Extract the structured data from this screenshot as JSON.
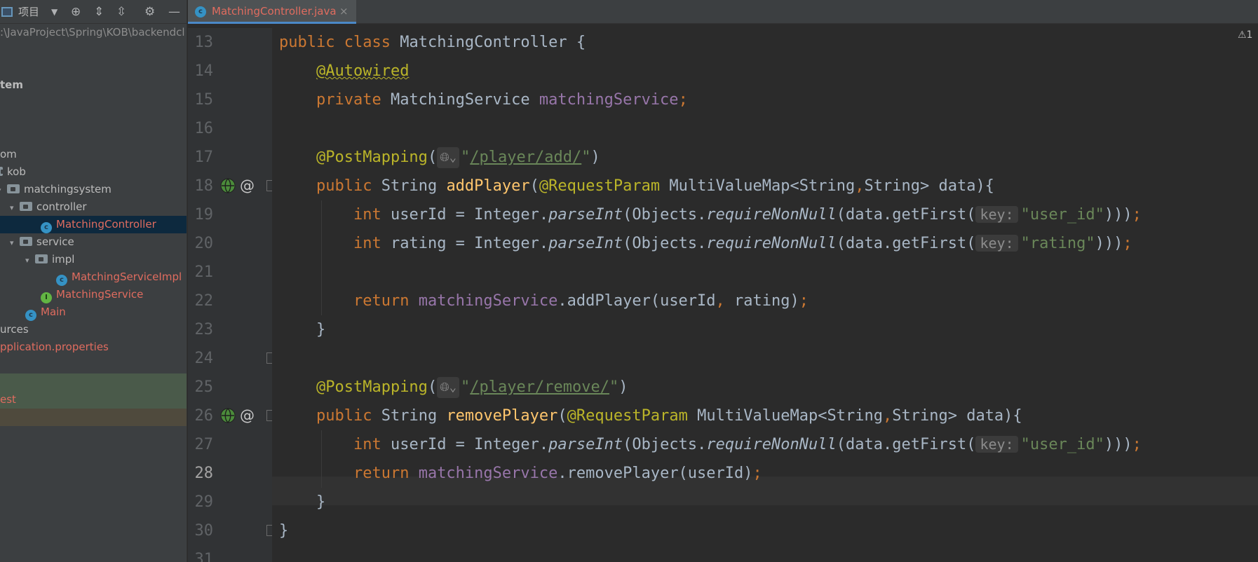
{
  "project_panel": {
    "title": "项目",
    "path": ":\\JavaProject\\Spring\\KOB\\backendcl",
    "tree": [
      {
        "label": "tem",
        "style": "plain"
      },
      {
        "label": "om",
        "style": "plain"
      },
      {
        "label": "kob",
        "style": "plain"
      },
      {
        "label": "matchingsystem",
        "style": "plain"
      },
      {
        "label": "controller",
        "style": "plain"
      },
      {
        "label": "MatchingController",
        "style": "red"
      },
      {
        "label": "service",
        "style": "plain"
      },
      {
        "label": "impl",
        "style": "plain"
      },
      {
        "label": "MatchingServiceImpl",
        "style": "red"
      },
      {
        "label": "MatchingService",
        "style": "red"
      },
      {
        "label": "Main",
        "style": "red"
      },
      {
        "label": "urces",
        "style": "plain"
      },
      {
        "label": "pplication.properties",
        "style": "red"
      },
      {
        "label": "est",
        "style": "red"
      }
    ]
  },
  "editor": {
    "tab_label": "MatchingController.java",
    "tab_close": "×",
    "warning": "⚠1",
    "hint_key": "key:",
    "line_numbers": [
      "13",
      "14",
      "15",
      "16",
      "17",
      "18",
      "19",
      "20",
      "21",
      "22",
      "23",
      "24",
      "25",
      "26",
      "27",
      "28",
      "29",
      "30",
      "31"
    ],
    "current_line": "28",
    "code": {
      "l13_kw1": "public",
      "l13_kw2": "class",
      "l13_rest": " MatchingController {",
      "l14_ann": "@Autowired",
      "l15_kw": "private",
      "l15_type": " MatchingService ",
      "l15_fld": "matchingService",
      "l15_semi": ";",
      "l17_ann": "@PostMapping",
      "l17_open": "(",
      "l17_q1": "\"",
      "l17_path": "/player/add/",
      "l17_q2": "\"",
      "l17_close": ")",
      "l18_kw": "public",
      "l18_type": " String ",
      "l18_mth": "addPlayer",
      "l18_open": "(",
      "l18_ann": "@RequestParam",
      "l18_rest1": " MultiValueMap<String",
      "l18_comma": ",",
      "l18_rest2": "String> data){",
      "l19_kw": "int",
      "l19_a": " userId = Integer.",
      "l19_parse": "parseInt",
      "l19_b": "(Objects.",
      "l19_req": "requireNonNull",
      "l19_c": "(data.getFirst(",
      "l19_str": "\"user_id\"",
      "l19_d": ")))",
      "l19_semi": ";",
      "l20_kw": "int",
      "l20_a": " rating = Integer.",
      "l20_parse": "parseInt",
      "l20_b": "(Objects.",
      "l20_req": "requireNonNull",
      "l20_c": "(data.getFirst(",
      "l20_str": "\"rating\"",
      "l20_d": ")))",
      "l20_semi": ";",
      "l22_kw": "return",
      "l22_fld": " matchingService",
      "l22_a": ".addPlayer(userId",
      "l22_comma": ",",
      "l22_b": " rating)",
      "l22_semi": ";",
      "l23": "}",
      "l25_ann": "@PostMapping",
      "l25_open": "(",
      "l25_q1": "\"",
      "l25_path": "/player/remove/",
      "l25_q2": "\"",
      "l25_close": ")",
      "l26_kw": "public",
      "l26_type": " String ",
      "l26_mth": "removePlayer",
      "l26_open": "(",
      "l26_ann": "@RequestParam",
      "l26_rest1": " MultiValueMap<String",
      "l26_comma": ",",
      "l26_rest2": "String> data){",
      "l27_kw": "int",
      "l27_a": " userId = Integer.",
      "l27_parse": "parseInt",
      "l27_b": "(Objects.",
      "l27_req": "requireNonNull",
      "l27_c": "(data.getFirst(",
      "l27_str": "\"user_id\"",
      "l27_d": ")))",
      "l27_semi": ";",
      "l28_kw": "return",
      "l28_fld": " matchingService",
      "l28_a": ".removePlayer(userId)",
      "l28_semi": ";",
      "l29": "}",
      "l30": "}"
    }
  }
}
